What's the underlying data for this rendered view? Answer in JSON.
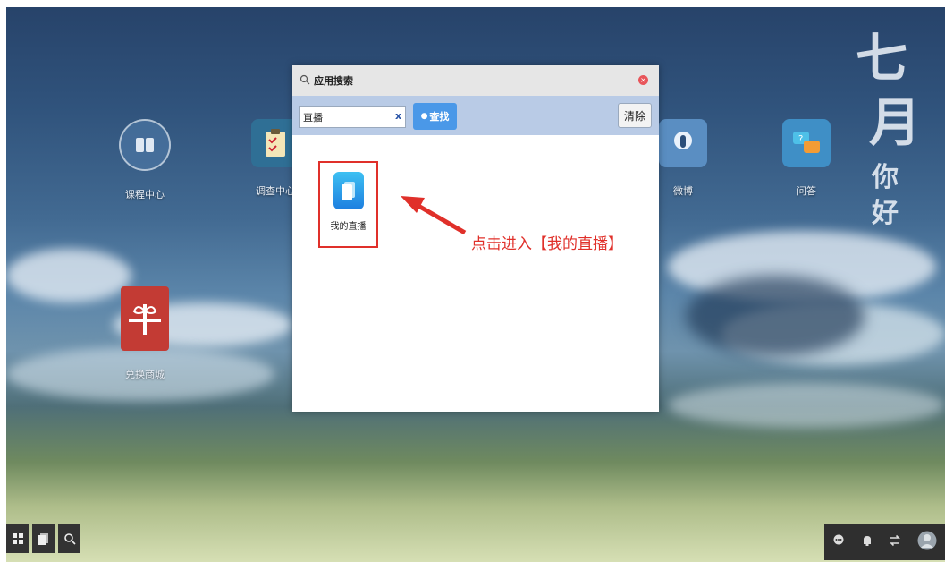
{
  "desktop": {
    "apps": [
      {
        "label": "课程中心",
        "icon": "book-icon",
        "color": "#4f79a8"
      },
      {
        "label": "调查中心",
        "icon": "clipboard-icon",
        "color": "#3a7aa0"
      },
      {
        "label": "微博",
        "icon": "microphone-icon",
        "color": "#5a8ec2"
      },
      {
        "label": "问答",
        "icon": "chat-bubbles-icon",
        "color": "#3f8fc6"
      },
      {
        "label": "兑换商城",
        "icon": "gift-icon",
        "color": "#c33b34"
      }
    ],
    "decoration": [
      "七",
      "月",
      "你",
      "好"
    ]
  },
  "dialog": {
    "title": "应用搜索",
    "search_value": "直播",
    "clear_label": "x",
    "find_label": "查找",
    "reset_label": "清除",
    "result": {
      "label": "我的直播",
      "icon": "live-app-icon"
    }
  },
  "annotation": "点击进入【我的直播】",
  "taskbar": {
    "left": [
      "grid-menu-icon",
      "window-icon",
      "search-icon"
    ],
    "right": [
      "chat-icon",
      "bell-icon",
      "swap-icon",
      "avatar-icon"
    ]
  }
}
